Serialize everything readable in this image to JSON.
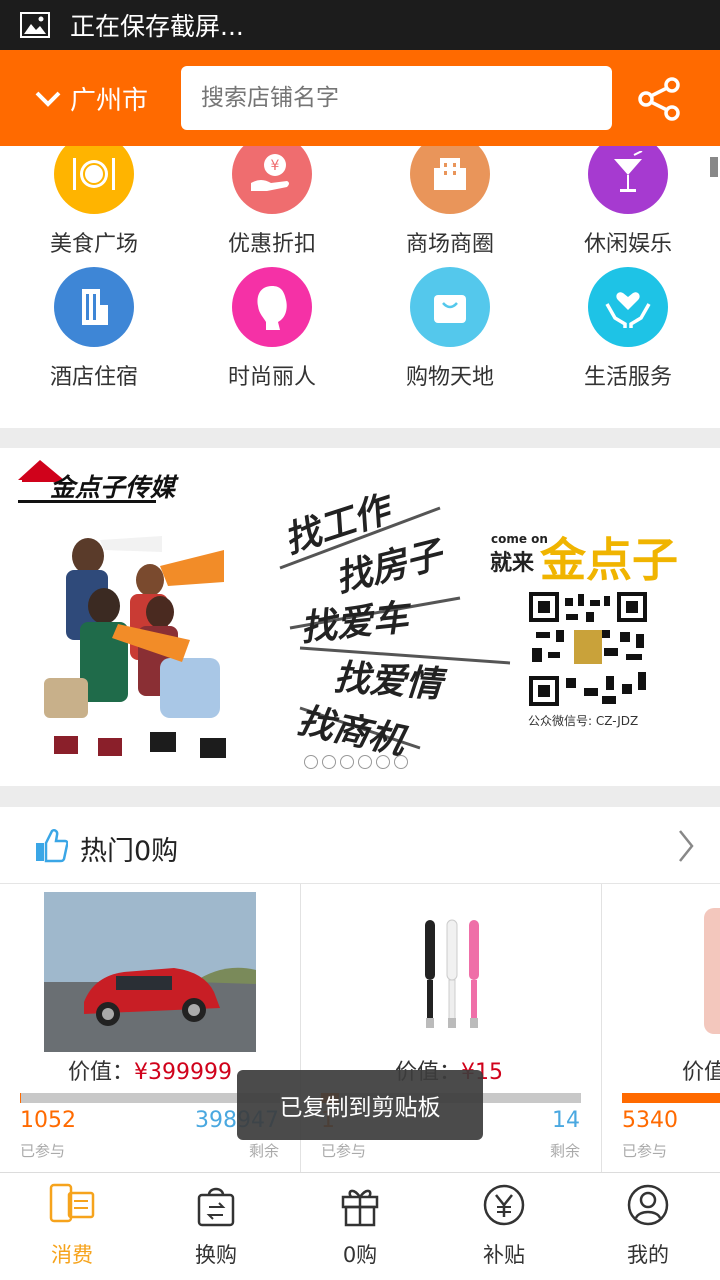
{
  "status_bar": {
    "text": "正在保存截屏...",
    "icon": "image-icon"
  },
  "header": {
    "city": "广州市",
    "search_placeholder": "搜索店铺名字",
    "brand_color": "#ff6a00"
  },
  "categories": [
    {
      "label": "美食广场",
      "icon": "dining-icon",
      "color": "#ffb400"
    },
    {
      "label": "优惠折扣",
      "icon": "yuan-hand-icon",
      "color": "#ef6d6f"
    },
    {
      "label": "商场商圈",
      "icon": "mall-building-icon",
      "color": "#e9955a"
    },
    {
      "label": "休闲娱乐",
      "icon": "cocktail-icon",
      "color": "#a63ad0"
    },
    {
      "label": "酒店住宿",
      "icon": "hotel-building-icon",
      "color": "#3e86d6"
    },
    {
      "label": "时尚丽人",
      "icon": "woman-profile-icon",
      "color": "#f531a6"
    },
    {
      "label": "购物天地",
      "icon": "shopping-bag-icon",
      "color": "#54c8ec"
    },
    {
      "label": "生活服务",
      "icon": "heart-hands-icon",
      "color": "#1ec3e6"
    }
  ],
  "banner": {
    "logo": "金点子传媒",
    "slogans": [
      "找工作",
      "找房子",
      "找爱车",
      "找爱情",
      "找商机"
    ],
    "come_on": "come on",
    "jiulai": "就来",
    "brand": "金点子",
    "wechat": "公众微信号: CZ-JDZ",
    "dots": 6,
    "active_dot": 0
  },
  "hot": {
    "title": "热门0购",
    "products": [
      {
        "value_label": "价值：",
        "value": "¥399999",
        "joined": "1052",
        "joined_label": "已参与",
        "remaining": "398947",
        "remaining_label": "剩余",
        "progress": 0.003,
        "image": "red-car"
      },
      {
        "value_label": "价值：",
        "value": "¥15",
        "joined": "1",
        "joined_label": "已参与",
        "remaining": "14",
        "remaining_label": "剩余",
        "progress": 0.07,
        "image": "usb-lamps"
      },
      {
        "value_label": "价值",
        "value": "",
        "joined": "5340",
        "joined_label": "已参与",
        "remaining": "",
        "remaining_label": "",
        "progress": 1.0,
        "image": "phone"
      }
    ]
  },
  "toast": "已复制到剪贴板",
  "tabs": [
    {
      "label": "消费",
      "icon": "phone-card-icon",
      "active": true
    },
    {
      "label": "换购",
      "icon": "exchange-bag-icon",
      "active": false
    },
    {
      "label": "0购",
      "icon": "gift-icon",
      "active": false
    },
    {
      "label": "补贴",
      "icon": "yuan-circle-icon",
      "active": false
    },
    {
      "label": "我的",
      "icon": "user-icon",
      "active": false
    }
  ]
}
